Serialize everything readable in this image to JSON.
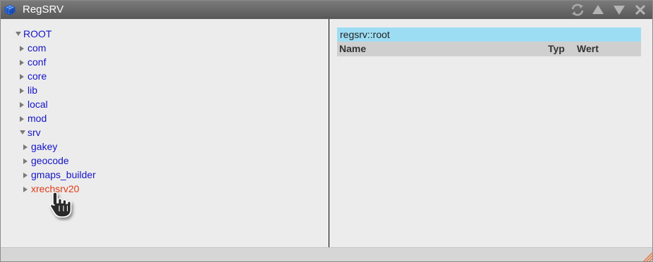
{
  "window": {
    "title": "RegSRV",
    "accent_color": "#e8743b"
  },
  "titlebar_buttons": [
    {
      "name": "refresh-button",
      "icon": "refresh-icon"
    },
    {
      "name": "move-up-button",
      "icon": "triangle-up-icon"
    },
    {
      "name": "move-down-button",
      "icon": "triangle-down-icon"
    },
    {
      "name": "close-button",
      "icon": "close-icon"
    }
  ],
  "tree": {
    "root": {
      "label": "ROOT",
      "expanded": true
    },
    "children": [
      {
        "label": "com",
        "expanded": false
      },
      {
        "label": "conf",
        "expanded": false
      },
      {
        "label": "core",
        "expanded": false
      },
      {
        "label": "lib",
        "expanded": false
      },
      {
        "label": "local",
        "expanded": false
      },
      {
        "label": "mod",
        "expanded": false
      },
      {
        "label": "srv",
        "expanded": true,
        "children": [
          {
            "label": "gakey",
            "expanded": false
          },
          {
            "label": "geocode",
            "expanded": false
          },
          {
            "label": "gmaps_builder",
            "expanded": false
          },
          {
            "label": "xrechsrv20",
            "expanded": false,
            "hovered": true
          }
        ]
      }
    ],
    "link_color": "#1515c8",
    "hover_color": "#e03a17"
  },
  "detail": {
    "path": "regsrv::root",
    "columns": {
      "name": "Name",
      "type": "Typ",
      "value": "Wert"
    }
  }
}
